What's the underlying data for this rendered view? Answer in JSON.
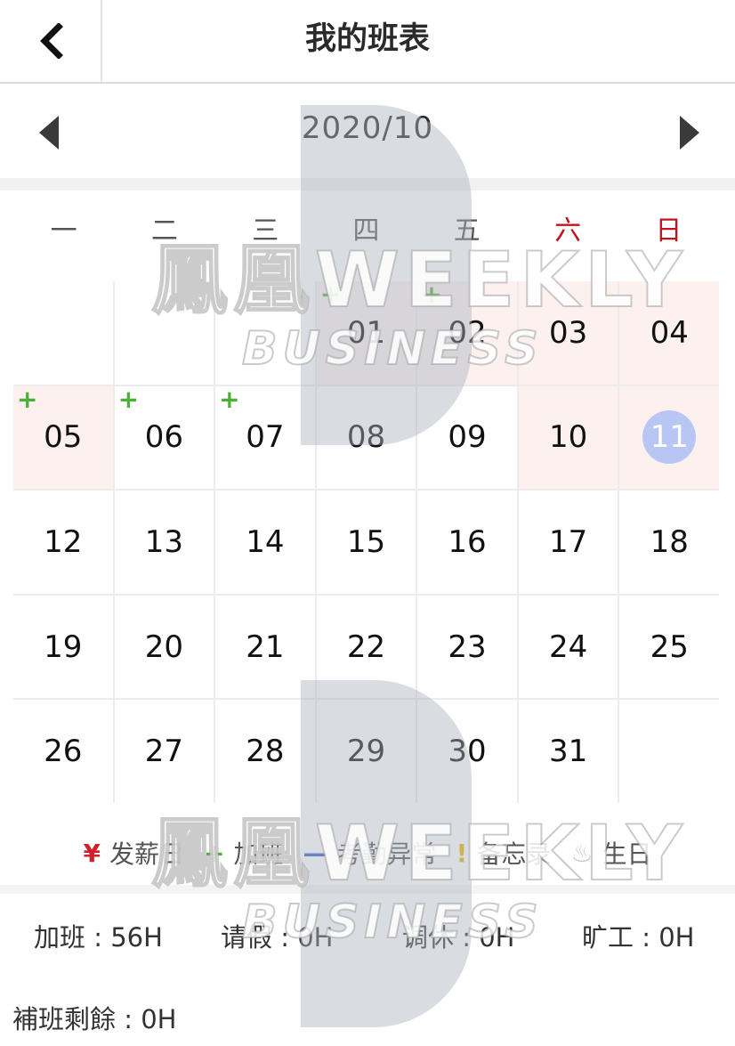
{
  "header": {
    "title": "我的班表",
    "back_icon": "chevron-left-icon"
  },
  "month_nav": {
    "label": "2020/10",
    "prev_icon": "triangle-left-icon",
    "next_icon": "triangle-right-icon"
  },
  "weekdays": [
    "一",
    "二",
    "三",
    "四",
    "五",
    "六",
    "日"
  ],
  "calendar": {
    "rows": [
      [
        {
          "day": "",
          "holiday": false,
          "overtime": false,
          "today": false
        },
        {
          "day": "",
          "holiday": false,
          "overtime": false,
          "today": false
        },
        {
          "day": "",
          "holiday": false,
          "overtime": false,
          "today": false
        },
        {
          "day": "01",
          "holiday": true,
          "overtime": true,
          "today": false
        },
        {
          "day": "02",
          "holiday": true,
          "overtime": true,
          "today": false
        },
        {
          "day": "03",
          "holiday": true,
          "overtime": false,
          "today": false
        },
        {
          "day": "04",
          "holiday": true,
          "overtime": false,
          "today": false
        }
      ],
      [
        {
          "day": "05",
          "holiday": true,
          "overtime": true,
          "today": false
        },
        {
          "day": "06",
          "holiday": false,
          "overtime": true,
          "today": false
        },
        {
          "day": "07",
          "holiday": false,
          "overtime": true,
          "today": false
        },
        {
          "day": "08",
          "holiday": false,
          "overtime": false,
          "today": false
        },
        {
          "day": "09",
          "holiday": false,
          "overtime": false,
          "today": false
        },
        {
          "day": "10",
          "holiday": true,
          "overtime": false,
          "today": false
        },
        {
          "day": "11",
          "holiday": true,
          "overtime": false,
          "today": true
        }
      ],
      [
        {
          "day": "12",
          "holiday": false,
          "overtime": false,
          "today": false
        },
        {
          "day": "13",
          "holiday": false,
          "overtime": false,
          "today": false
        },
        {
          "day": "14",
          "holiday": false,
          "overtime": false,
          "today": false
        },
        {
          "day": "15",
          "holiday": false,
          "overtime": false,
          "today": false
        },
        {
          "day": "16",
          "holiday": false,
          "overtime": false,
          "today": false
        },
        {
          "day": "17",
          "holiday": false,
          "overtime": false,
          "today": false
        },
        {
          "day": "18",
          "holiday": false,
          "overtime": false,
          "today": false
        }
      ],
      [
        {
          "day": "19",
          "holiday": false,
          "overtime": false,
          "today": false
        },
        {
          "day": "20",
          "holiday": false,
          "overtime": false,
          "today": false
        },
        {
          "day": "21",
          "holiday": false,
          "overtime": false,
          "today": false
        },
        {
          "day": "22",
          "holiday": false,
          "overtime": false,
          "today": false
        },
        {
          "day": "23",
          "holiday": false,
          "overtime": false,
          "today": false
        },
        {
          "day": "24",
          "holiday": false,
          "overtime": false,
          "today": false
        },
        {
          "day": "25",
          "holiday": false,
          "overtime": false,
          "today": false
        }
      ],
      [
        {
          "day": "26",
          "holiday": false,
          "overtime": false,
          "today": false
        },
        {
          "day": "27",
          "holiday": false,
          "overtime": false,
          "today": false
        },
        {
          "day": "28",
          "holiday": false,
          "overtime": false,
          "today": false
        },
        {
          "day": "29",
          "holiday": false,
          "overtime": false,
          "today": false
        },
        {
          "day": "30",
          "holiday": false,
          "overtime": false,
          "today": false
        },
        {
          "day": "31",
          "holiday": false,
          "overtime": false,
          "today": false
        },
        {
          "day": "",
          "holiday": false,
          "overtime": false,
          "today": false
        }
      ]
    ],
    "overtime_symbol": "+",
    "colors": {
      "holiday_bg": "#fdf1f0",
      "today_circle": "#b8c6f4",
      "overtime_mark": "#4caf3a",
      "weekend_text": "#c0141c"
    }
  },
  "legend": {
    "payday": {
      "symbol": "¥",
      "label": "发薪日"
    },
    "overtime": {
      "symbol": "+",
      "label": "加班"
    },
    "attendance": {
      "symbol": "—",
      "label": "考勤异常"
    },
    "memo": {
      "symbol": "!",
      "label": "备忘录"
    },
    "birthday": {
      "symbol": "♨",
      "label": "生日"
    }
  },
  "summary": {
    "overtime": "加班 : 56H",
    "leave": "请假 : 0H",
    "rest": "调休 : 0H",
    "absent": "旷工 : 0H",
    "remaining": "補班剩餘 : 0H"
  },
  "watermark": {
    "brand": "鳳凰WEEKLY",
    "sub": "BUSINESS"
  }
}
